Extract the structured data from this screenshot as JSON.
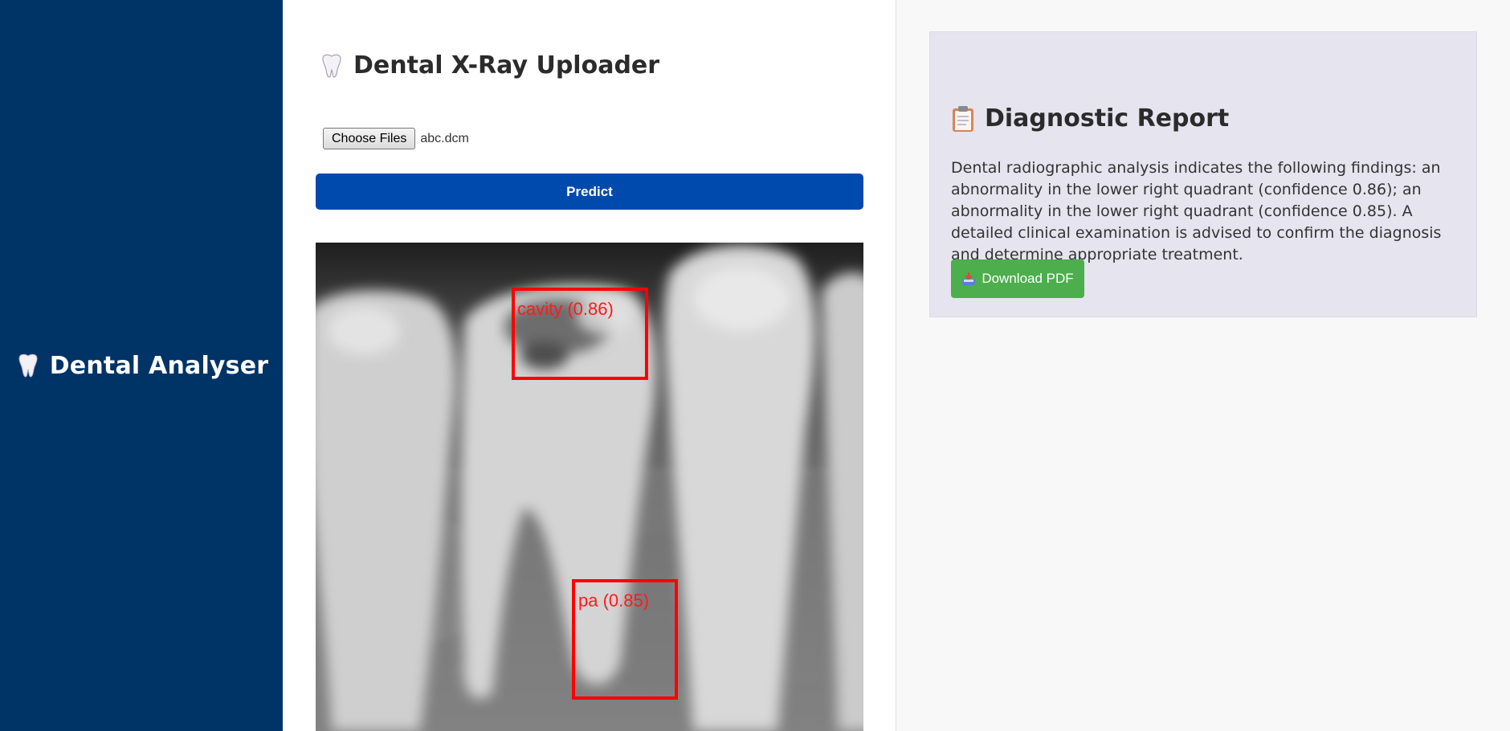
{
  "sidebar": {
    "brand_title": "Dental Analyser",
    "brand_icon": "tooth-icon"
  },
  "uploader": {
    "title": "Dental X-Ray Uploader",
    "title_icon": "tooth-icon",
    "choose_files_label": "Choose Files",
    "selected_file": "abc.dcm",
    "predict_label": "Predict"
  },
  "xray": {
    "detections": [
      {
        "label": "cavity (0.86)",
        "color": "#ff0000"
      },
      {
        "label": "pa (0.85)",
        "color": "#ff0000"
      }
    ]
  },
  "report": {
    "title": "Diagnostic Report",
    "title_icon": "clipboard-icon",
    "text": "Dental radiographic analysis indicates the following findings: an abnormality in the lower right quadrant (confidence 0.86); an abnormality in the lower right quadrant (confidence 0.85). A detailed clinical examination is advised to confirm the diagnosis and determine appropriate treatment.",
    "download_label": "Download PDF",
    "download_icon": "inbox-tray-icon"
  },
  "colors": {
    "sidebar_bg": "#003366",
    "predict_bg": "#004aad",
    "download_bg": "#4cae4c",
    "report_bg": "#e6e4ef"
  }
}
